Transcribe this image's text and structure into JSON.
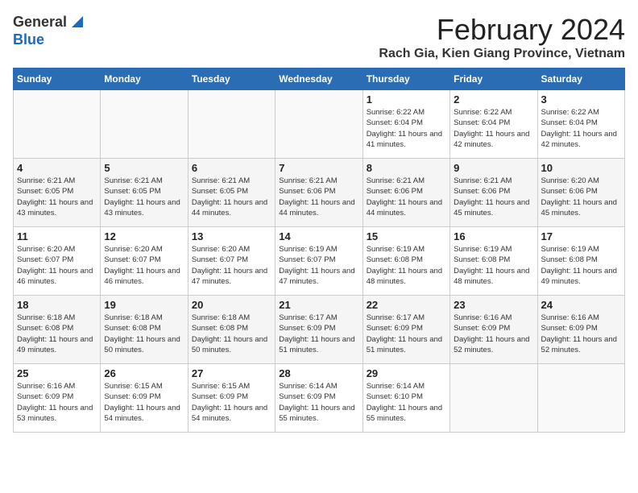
{
  "logo": {
    "general": "General",
    "blue": "Blue"
  },
  "title": {
    "month_year": "February 2024",
    "location": "Rach Gia, Kien Giang Province, Vietnam"
  },
  "calendar": {
    "headers": [
      "Sunday",
      "Monday",
      "Tuesday",
      "Wednesday",
      "Thursday",
      "Friday",
      "Saturday"
    ],
    "weeks": [
      [
        {
          "day": "",
          "detail": ""
        },
        {
          "day": "",
          "detail": ""
        },
        {
          "day": "",
          "detail": ""
        },
        {
          "day": "",
          "detail": ""
        },
        {
          "day": "1",
          "detail": "Sunrise: 6:22 AM\nSunset: 6:04 PM\nDaylight: 11 hours and 41 minutes."
        },
        {
          "day": "2",
          "detail": "Sunrise: 6:22 AM\nSunset: 6:04 PM\nDaylight: 11 hours and 42 minutes."
        },
        {
          "day": "3",
          "detail": "Sunrise: 6:22 AM\nSunset: 6:04 PM\nDaylight: 11 hours and 42 minutes."
        }
      ],
      [
        {
          "day": "4",
          "detail": "Sunrise: 6:21 AM\nSunset: 6:05 PM\nDaylight: 11 hours and 43 minutes."
        },
        {
          "day": "5",
          "detail": "Sunrise: 6:21 AM\nSunset: 6:05 PM\nDaylight: 11 hours and 43 minutes."
        },
        {
          "day": "6",
          "detail": "Sunrise: 6:21 AM\nSunset: 6:05 PM\nDaylight: 11 hours and 44 minutes."
        },
        {
          "day": "7",
          "detail": "Sunrise: 6:21 AM\nSunset: 6:06 PM\nDaylight: 11 hours and 44 minutes."
        },
        {
          "day": "8",
          "detail": "Sunrise: 6:21 AM\nSunset: 6:06 PM\nDaylight: 11 hours and 44 minutes."
        },
        {
          "day": "9",
          "detail": "Sunrise: 6:21 AM\nSunset: 6:06 PM\nDaylight: 11 hours and 45 minutes."
        },
        {
          "day": "10",
          "detail": "Sunrise: 6:20 AM\nSunset: 6:06 PM\nDaylight: 11 hours and 45 minutes."
        }
      ],
      [
        {
          "day": "11",
          "detail": "Sunrise: 6:20 AM\nSunset: 6:07 PM\nDaylight: 11 hours and 46 minutes."
        },
        {
          "day": "12",
          "detail": "Sunrise: 6:20 AM\nSunset: 6:07 PM\nDaylight: 11 hours and 46 minutes."
        },
        {
          "day": "13",
          "detail": "Sunrise: 6:20 AM\nSunset: 6:07 PM\nDaylight: 11 hours and 47 minutes."
        },
        {
          "day": "14",
          "detail": "Sunrise: 6:19 AM\nSunset: 6:07 PM\nDaylight: 11 hours and 47 minutes."
        },
        {
          "day": "15",
          "detail": "Sunrise: 6:19 AM\nSunset: 6:08 PM\nDaylight: 11 hours and 48 minutes."
        },
        {
          "day": "16",
          "detail": "Sunrise: 6:19 AM\nSunset: 6:08 PM\nDaylight: 11 hours and 48 minutes."
        },
        {
          "day": "17",
          "detail": "Sunrise: 6:19 AM\nSunset: 6:08 PM\nDaylight: 11 hours and 49 minutes."
        }
      ],
      [
        {
          "day": "18",
          "detail": "Sunrise: 6:18 AM\nSunset: 6:08 PM\nDaylight: 11 hours and 49 minutes."
        },
        {
          "day": "19",
          "detail": "Sunrise: 6:18 AM\nSunset: 6:08 PM\nDaylight: 11 hours and 50 minutes."
        },
        {
          "day": "20",
          "detail": "Sunrise: 6:18 AM\nSunset: 6:08 PM\nDaylight: 11 hours and 50 minutes."
        },
        {
          "day": "21",
          "detail": "Sunrise: 6:17 AM\nSunset: 6:09 PM\nDaylight: 11 hours and 51 minutes."
        },
        {
          "day": "22",
          "detail": "Sunrise: 6:17 AM\nSunset: 6:09 PM\nDaylight: 11 hours and 51 minutes."
        },
        {
          "day": "23",
          "detail": "Sunrise: 6:16 AM\nSunset: 6:09 PM\nDaylight: 11 hours and 52 minutes."
        },
        {
          "day": "24",
          "detail": "Sunrise: 6:16 AM\nSunset: 6:09 PM\nDaylight: 11 hours and 52 minutes."
        }
      ],
      [
        {
          "day": "25",
          "detail": "Sunrise: 6:16 AM\nSunset: 6:09 PM\nDaylight: 11 hours and 53 minutes."
        },
        {
          "day": "26",
          "detail": "Sunrise: 6:15 AM\nSunset: 6:09 PM\nDaylight: 11 hours and 54 minutes."
        },
        {
          "day": "27",
          "detail": "Sunrise: 6:15 AM\nSunset: 6:09 PM\nDaylight: 11 hours and 54 minutes."
        },
        {
          "day": "28",
          "detail": "Sunrise: 6:14 AM\nSunset: 6:09 PM\nDaylight: 11 hours and 55 minutes."
        },
        {
          "day": "29",
          "detail": "Sunrise: 6:14 AM\nSunset: 6:10 PM\nDaylight: 11 hours and 55 minutes."
        },
        {
          "day": "",
          "detail": ""
        },
        {
          "day": "",
          "detail": ""
        }
      ]
    ]
  }
}
